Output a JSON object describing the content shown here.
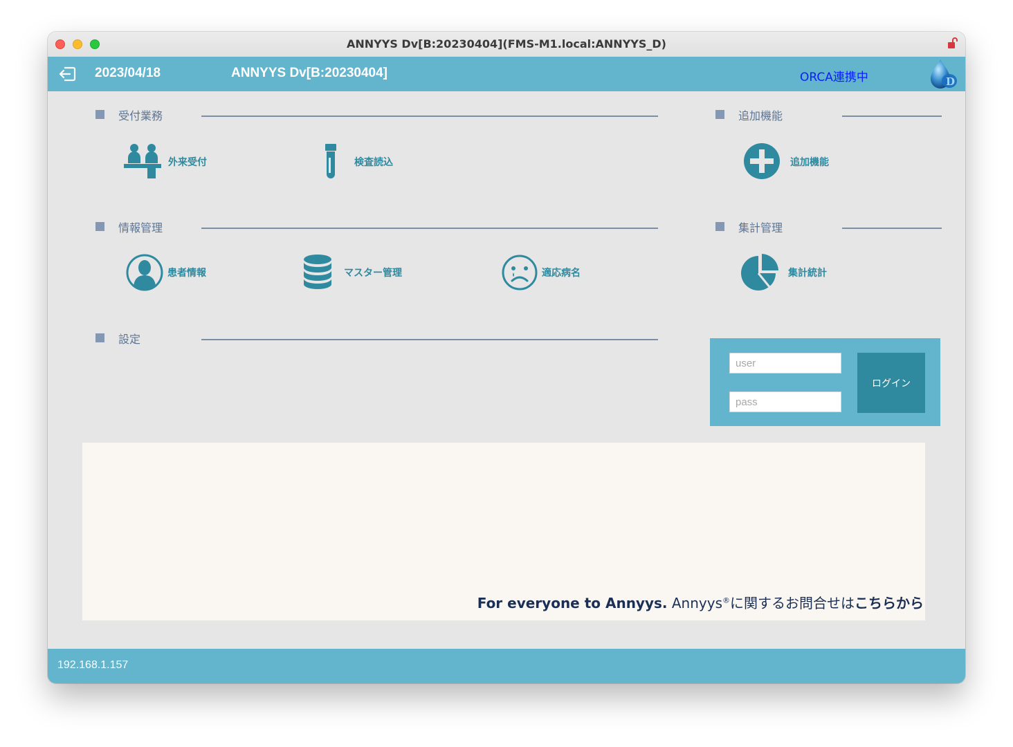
{
  "window": {
    "title": "ANNYYS Dv[B:20230404](FMS-M1.local:ANNYYS_D)"
  },
  "header": {
    "date": "2023/04/18",
    "app_name": "ANNYYS Dv[B:20230404]",
    "orca_status": "ORCA連携中",
    "orca_status_color": "#0a1eff",
    "bar_color": "#62b5cc"
  },
  "sections": {
    "reception": {
      "title": "受付業務",
      "items": [
        {
          "label": "外来受付",
          "icon": "reception-desk-icon"
        },
        {
          "label": "検査読込",
          "icon": "test-tube-icon"
        }
      ]
    },
    "extra": {
      "title": "追加機能",
      "items": [
        {
          "label": "追加機能",
          "icon": "plus-circle-icon"
        }
      ]
    },
    "info": {
      "title": "情報管理",
      "items": [
        {
          "label": "患者情報",
          "icon": "patient-avatar-icon"
        },
        {
          "label": "マスター管理",
          "icon": "database-icon"
        },
        {
          "label": "適応病名",
          "icon": "sad-face-icon"
        }
      ]
    },
    "stats": {
      "title": "集計管理",
      "items": [
        {
          "label": "集計統計",
          "icon": "pie-chart-icon"
        }
      ]
    },
    "settings": {
      "title": "設定"
    }
  },
  "login": {
    "user_placeholder": "user",
    "pass_placeholder": "pass",
    "button_label": "ログイン"
  },
  "footer": {
    "tagline": "For everyone to Annyys.",
    "brand": "Annyys",
    "registered": "®",
    "inquiry_text": "に関するお問合せは",
    "link_text": "こちらから"
  },
  "status": {
    "ip": "192.168.1.157"
  },
  "colors": {
    "accent": "#62b5cc",
    "icon": "#2f8aa0",
    "section_text": "#5d7593",
    "background": "#e6e6e6"
  }
}
